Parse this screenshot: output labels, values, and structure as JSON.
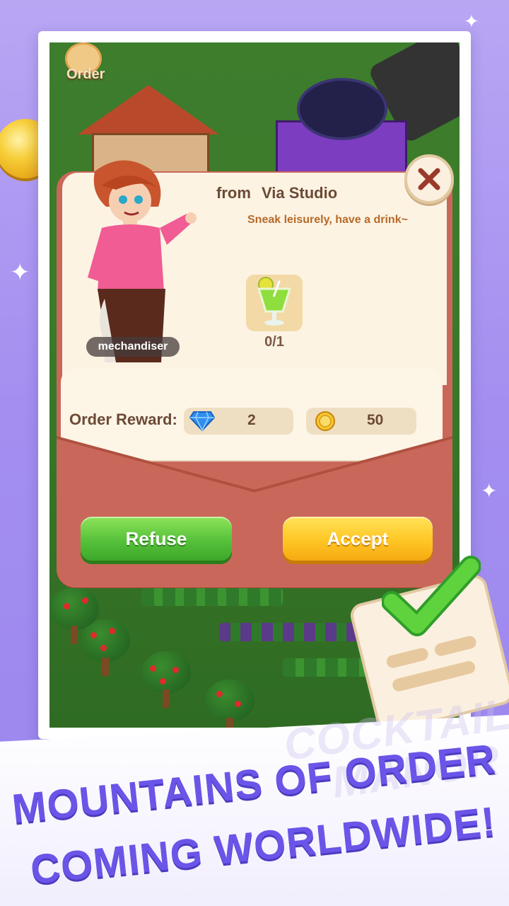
{
  "scene": {
    "order_button_label": "Order"
  },
  "dialog": {
    "from_label": "from",
    "sender_name": "Via Studio",
    "subtitle": "Sneak leisurely, have a drink~",
    "character_tag": "mechandiser",
    "item_icon": "cocktail-icon",
    "item_progress": "0/1",
    "reward_label": "Order Reward:",
    "rewards": [
      {
        "icon": "diamond-icon",
        "value": "2"
      },
      {
        "icon": "coin-icon",
        "value": "50"
      }
    ],
    "refuse_label": "Refuse",
    "accept_label": "Accept"
  },
  "banner": {
    "headline_line1": "MOUNTAINS OF ORDER",
    "headline_line2": "COMING WORLDWIDE!",
    "watermark_line1": "COCKTAIL",
    "watermark_line2": "MANOR"
  },
  "colors": {
    "headline": "#6a55e8",
    "refuse_button": "#56c13a",
    "accept_button": "#ffc624",
    "dialog_frame": "#c9685a"
  }
}
